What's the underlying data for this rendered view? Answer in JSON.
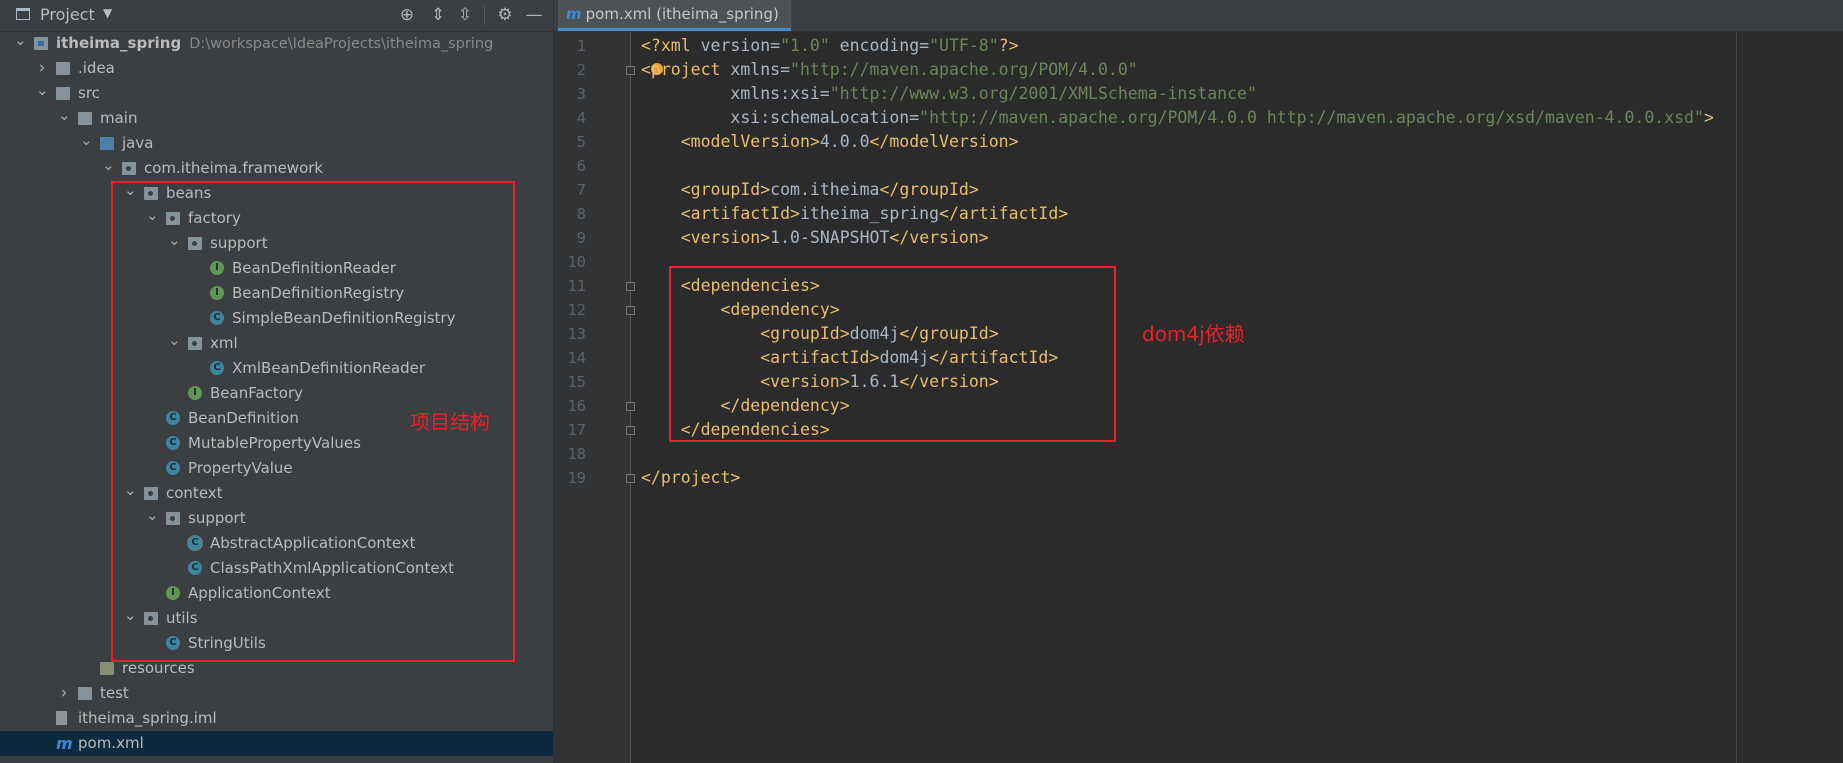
{
  "project_panel": {
    "title": "Project",
    "buttons": [
      "locate-icon",
      "expand-all-icon",
      "collapse-all-icon",
      "gear-icon",
      "hide-icon"
    ]
  },
  "tree": [
    {
      "level": 0,
      "arrow": "down",
      "icon": "module-folder",
      "label": "itheima_spring",
      "bold": true,
      "path": "D:\\workspace\\IdeaProjects\\itheima_spring"
    },
    {
      "level": 1,
      "arrow": "right",
      "icon": "folder",
      "label": ".idea"
    },
    {
      "level": 1,
      "arrow": "down",
      "icon": "folder",
      "label": "src"
    },
    {
      "level": 2,
      "arrow": "down",
      "icon": "folder",
      "label": "main"
    },
    {
      "level": 3,
      "arrow": "down",
      "icon": "source-folder",
      "label": "java"
    },
    {
      "level": 4,
      "arrow": "down",
      "icon": "package",
      "label": "com.itheima.framework"
    },
    {
      "level": 5,
      "arrow": "down",
      "icon": "package",
      "label": "beans"
    },
    {
      "level": 6,
      "arrow": "down",
      "icon": "package",
      "label": "factory"
    },
    {
      "level": 7,
      "arrow": "down",
      "icon": "package",
      "label": "support"
    },
    {
      "level": 8,
      "arrow": "",
      "icon": "interface",
      "label": "BeanDefinitionReader"
    },
    {
      "level": 8,
      "arrow": "",
      "icon": "interface",
      "label": "BeanDefinitionRegistry"
    },
    {
      "level": 8,
      "arrow": "",
      "icon": "class",
      "label": "SimpleBeanDefinitionRegistry"
    },
    {
      "level": 7,
      "arrow": "down",
      "icon": "package",
      "label": "xml"
    },
    {
      "level": 8,
      "arrow": "",
      "icon": "class",
      "label": "XmlBeanDefinitionReader"
    },
    {
      "level": 7,
      "arrow": "",
      "icon": "interface",
      "label": "BeanFactory"
    },
    {
      "level": 6,
      "arrow": "",
      "icon": "class",
      "label": "BeanDefinition"
    },
    {
      "level": 6,
      "arrow": "",
      "icon": "class",
      "label": "MutablePropertyValues"
    },
    {
      "level": 6,
      "arrow": "",
      "icon": "class",
      "label": "PropertyValue"
    },
    {
      "level": 5,
      "arrow": "down",
      "icon": "package",
      "label": "context"
    },
    {
      "level": 6,
      "arrow": "down",
      "icon": "package",
      "label": "support"
    },
    {
      "level": 7,
      "arrow": "",
      "icon": "abstract-class",
      "label": "AbstractApplicationContext"
    },
    {
      "level": 7,
      "arrow": "",
      "icon": "class",
      "label": "ClassPathXmlApplicationContext"
    },
    {
      "level": 6,
      "arrow": "",
      "icon": "interface",
      "label": "ApplicationContext"
    },
    {
      "level": 5,
      "arrow": "down",
      "icon": "package",
      "label": "utils"
    },
    {
      "level": 6,
      "arrow": "",
      "icon": "class",
      "label": "StringUtils"
    },
    {
      "level": 3,
      "arrow": "",
      "icon": "resources-folder",
      "label": "resources"
    },
    {
      "level": 2,
      "arrow": "right",
      "icon": "folder",
      "label": "test"
    },
    {
      "level": 1,
      "arrow": "",
      "icon": "iml-file",
      "label": "itheima_spring.iml"
    },
    {
      "level": 1,
      "arrow": "",
      "icon": "maven-file",
      "label": "pom.xml",
      "selected": true
    }
  ],
  "annotation_left": "项目结构",
  "annotation_right": "dom4j依赖",
  "editor": {
    "tab_label": "pom.xml (itheima_spring)",
    "tab_icon": "m",
    "lines": [
      "<?xml version=\"1.0\" encoding=\"UTF-8\"?>",
      "<project xmlns=\"http://maven.apache.org/POM/4.0.0\"",
      "         xmlns:xsi=\"http://www.w3.org/2001/XMLSchema-instance\"",
      "         xsi:schemaLocation=\"http://maven.apache.org/POM/4.0.0 http://maven.apache.org/xsd/maven-4.0.0.xsd\">",
      "    <modelVersion>4.0.0</modelVersion>",
      "",
      "    <groupId>com.itheima</groupId>",
      "    <artifactId>itheima_spring</artifactId>",
      "    <version>1.0-SNAPSHOT</version>",
      "",
      "    <dependencies>",
      "        <dependency>",
      "            <groupId>dom4j</groupId>",
      "            <artifactId>dom4j</artifactId>",
      "            <version>1.6.1</version>",
      "        </dependency>",
      "    </dependencies>",
      "",
      "</project>"
    ]
  },
  "colors": {
    "panel_bg": "#3c3f41",
    "editor_bg": "#2b2b2b",
    "tag": "#e8bf6a",
    "attr_value": "#6a8759",
    "namespace": "#9876aa",
    "annotation_red": "#e8212b",
    "selection": "#0d293e"
  }
}
